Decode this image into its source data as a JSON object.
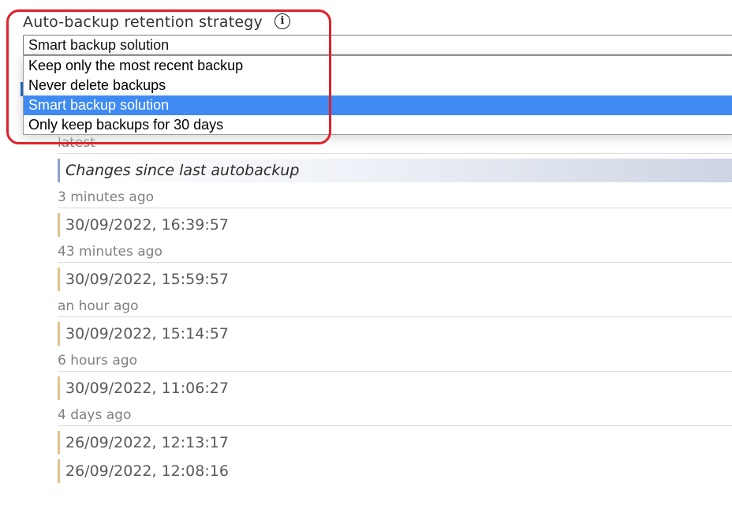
{
  "setting": {
    "label": "Auto-backup retention strategy",
    "info_icon": "info-icon"
  },
  "select": {
    "value": "Smart backup solution",
    "options": [
      {
        "label": "Keep only the most recent backup",
        "selected": false
      },
      {
        "label": "Never delete backups",
        "selected": false
      },
      {
        "label": "Smart backup solution",
        "selected": true
      },
      {
        "label": "Only keep backups for 30 days",
        "selected": false
      }
    ]
  },
  "backups": {
    "groups": [
      {
        "header": "latest",
        "items": [
          "Changes since last autobackup"
        ]
      },
      {
        "header": "3 minutes ago",
        "items": [
          "30/09/2022, 16:39:57"
        ]
      },
      {
        "header": "43 minutes ago",
        "items": [
          "30/09/2022, 15:59:57"
        ]
      },
      {
        "header": "an hour ago",
        "items": [
          "30/09/2022, 15:14:57"
        ]
      },
      {
        "header": "6 hours ago",
        "items": [
          "30/09/2022, 11:06:27"
        ]
      },
      {
        "header": "4 days ago",
        "items": [
          "26/09/2022, 12:13:17",
          "26/09/2022, 12:08:16"
        ]
      }
    ]
  },
  "colors": {
    "highlight": "#e0202a",
    "selected_option": "#3f8bf3",
    "item_marker": "#e1c48d",
    "current_marker": "#8da2c8"
  }
}
